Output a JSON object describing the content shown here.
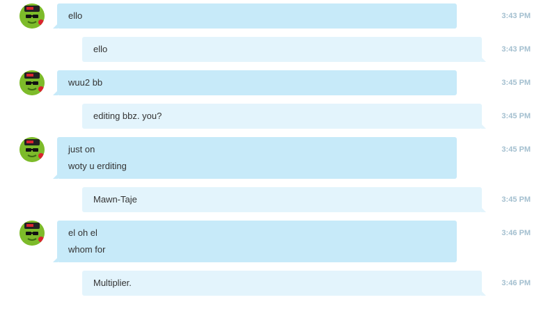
{
  "colors": {
    "incoming_bubble": "#c7eaf9",
    "outgoing_bubble": "#e3f4fc",
    "timestamp": "#a3bfcf"
  },
  "avatar_icon": "green-avatar-with-sunglasses-and-cap",
  "messages": [
    {
      "direction": "incoming",
      "lines": [
        "ello"
      ],
      "time": "3:43 PM"
    },
    {
      "direction": "outgoing",
      "lines": [
        "ello"
      ],
      "time": "3:43 PM"
    },
    {
      "direction": "incoming",
      "lines": [
        "wuu2 bb"
      ],
      "time": "3:45 PM"
    },
    {
      "direction": "outgoing",
      "lines": [
        "editing bbz. you?"
      ],
      "time": "3:45 PM"
    },
    {
      "direction": "incoming",
      "lines": [
        "just on",
        "woty u erditing"
      ],
      "time": "3:45 PM"
    },
    {
      "direction": "outgoing",
      "lines": [
        "Mawn-Taje"
      ],
      "time": "3:45 PM"
    },
    {
      "direction": "incoming",
      "lines": [
        "el oh el",
        "whom for"
      ],
      "time": "3:46 PM"
    },
    {
      "direction": "outgoing",
      "lines": [
        "Multiplier."
      ],
      "time": "3:46 PM"
    }
  ]
}
